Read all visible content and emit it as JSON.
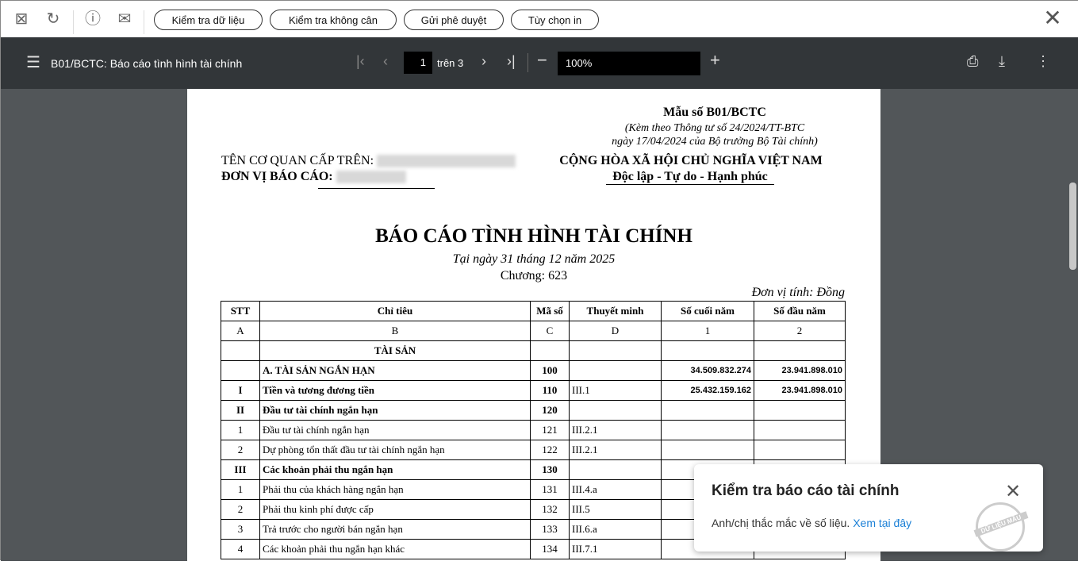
{
  "toolbar": {
    "buttons": [
      "Kiểm tra dữ liệu",
      "Kiểm tra không cân",
      "Gửi phê duyệt",
      "Tùy chọn in"
    ]
  },
  "viewer": {
    "title": "B01/BCTC: Báo cáo tình hình tài chính",
    "page": "1",
    "page_total": "trên 3",
    "zoom": "100%"
  },
  "doc": {
    "form_no": "Mẫu số B01/BCTC",
    "form_note1": "(Kèm theo Thông tư số 24/2024/TT-BTC",
    "form_note2": "ngày 17/04/2024 của Bộ trưởng Bộ Tài chính)",
    "superior_label": "TÊN CƠ QUAN CẤP TRÊN:",
    "unit_label": "ĐƠN VỊ BÁO CÁO:",
    "nation": "CỘNG HÒA XÃ HỘI CHỦ NGHĨA VIỆT NAM",
    "motto": "Độc lập - Tự do - Hạnh phúc",
    "title": "BÁO CÁO TÌNH HÌNH TÀI CHÍNH",
    "date": "Tại ngày 31 tháng 12 năm 2025",
    "chapter": "Chương: 623",
    "currency": "Đơn vị tính: Đồng",
    "headers": [
      "STT",
      "Chỉ tiêu",
      "Mã số",
      "Thuyết minh",
      "Số cuối năm",
      "Số đầu năm"
    ],
    "codes": [
      "A",
      "B",
      "C",
      "D",
      "1",
      "2"
    ],
    "rows": [
      [
        "",
        "TÀI SẢN",
        "",
        "",
        "",
        "",
        "c"
      ],
      [
        "",
        "A. TÀI SẢN NGẮN HẠN",
        "100",
        "",
        "34.509.832.274",
        "23.941.898.010",
        "b"
      ],
      [
        "I",
        "Tiền và tương đương tiền",
        "110",
        "III.1",
        "25.432.159.162",
        "23.941.898.010",
        "b"
      ],
      [
        "II",
        "Đầu tư tài chính ngắn hạn",
        "120",
        "",
        "",
        "",
        "b"
      ],
      [
        "1",
        "Đầu tư tài chính ngắn hạn",
        "121",
        "III.2.1",
        "",
        "",
        ""
      ],
      [
        "2",
        "Dự phòng tổn thất đầu tư tài chính ngắn hạn",
        "122",
        "III.2.1",
        "",
        "",
        ""
      ],
      [
        "III",
        "Các khoản phải thu ngắn hạn",
        "130",
        "",
        "",
        "",
        "b"
      ],
      [
        "1",
        "Phải thu của khách hàng ngắn hạn",
        "131",
        "III.4.a",
        "",
        "",
        ""
      ],
      [
        "2",
        "Phải thu kinh phí được cấp",
        "132",
        "III.5",
        "",
        "",
        ""
      ],
      [
        "3",
        "Trả trước cho người bán ngắn hạn",
        "133",
        "III.6.a",
        "",
        "",
        ""
      ],
      [
        "4",
        "Các khoản phải thu ngắn hạn khác",
        "134",
        "III.7.1",
        "",
        "",
        ""
      ]
    ]
  },
  "popup": {
    "title": "Kiểm tra báo cáo tài chính",
    "text": "Anh/chị thắc mắc về số liệu.",
    "link": "Xem tại đây",
    "stamp": "DỮ LIỆU MẪU"
  }
}
